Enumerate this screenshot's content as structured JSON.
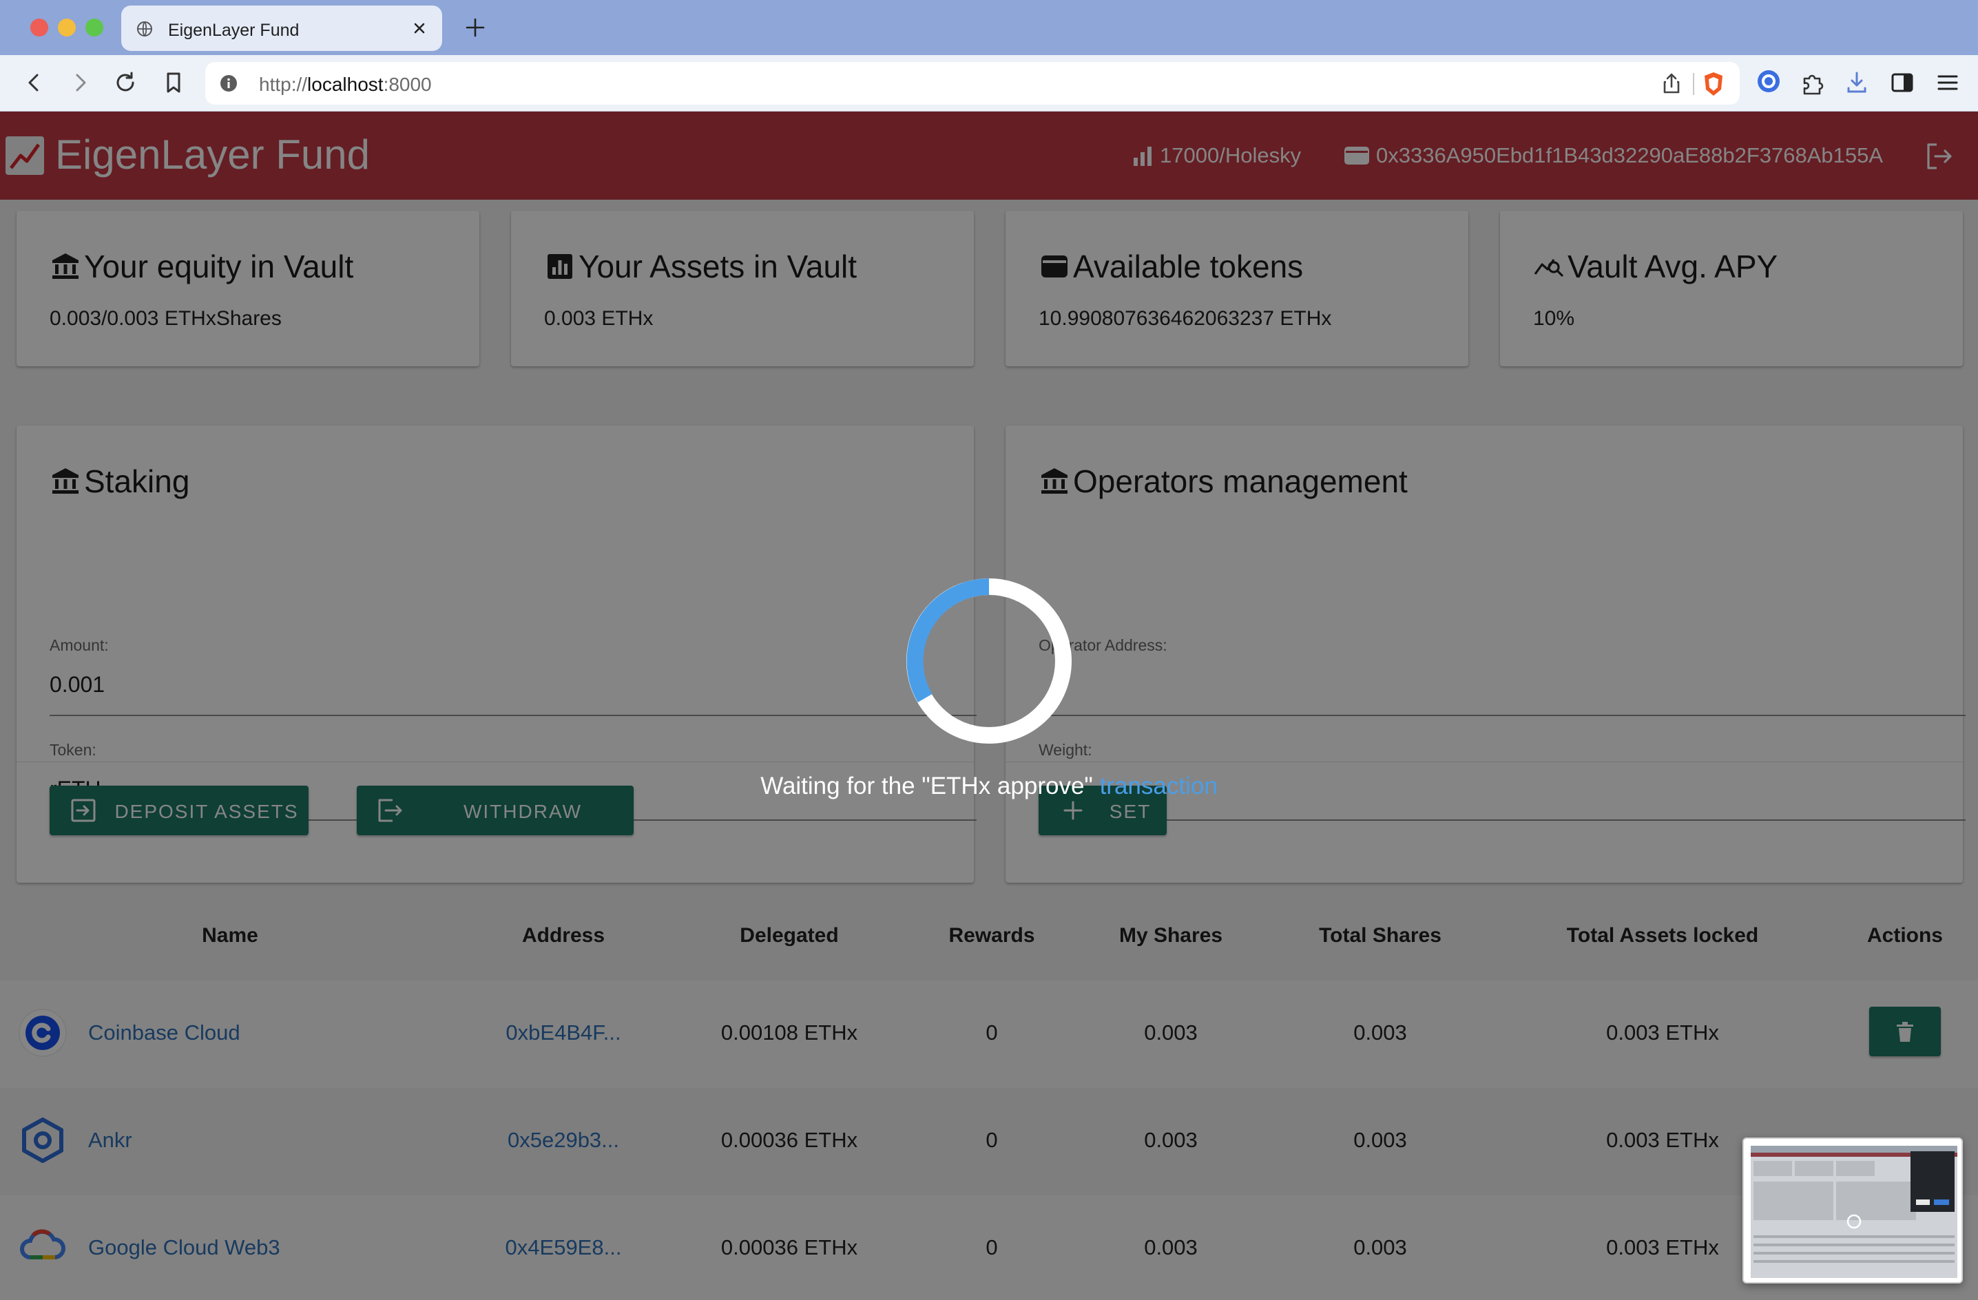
{
  "browser": {
    "tab_title": "EigenLayer Fund",
    "url_prefix": "http://",
    "url_host": "localhost",
    "url_port": ":8000"
  },
  "app": {
    "title": "EigenLayer Fund",
    "network": "17000/Holesky",
    "account": "0x3336A950Ebd1f1B43d32290aE88b2F3768Ab155A",
    "colors": {
      "appbar": "#c23b45",
      "primary_button": "#1d7a66",
      "link": "#2f6fb7",
      "spinner_accent": "#4a9ee8"
    }
  },
  "stats": [
    {
      "title": "Your equity in Vault",
      "value": "0.003/0.003 ETHxShares",
      "icon": "bank-icon"
    },
    {
      "title": "Your Assets in Vault",
      "value": "0.003 ETHx",
      "icon": "chart-box-icon"
    },
    {
      "title": "Available tokens",
      "value": "10.990807636462063237 ETHx",
      "icon": "wallet-icon"
    },
    {
      "title": "Vault Avg. APY",
      "value": "10%",
      "icon": "trend-search-icon"
    }
  ],
  "staking": {
    "title": "Staking",
    "amount_label": "Amount:",
    "amount_value": "0.001",
    "token_label": "Token:",
    "token_value": "rETH",
    "deposit_label": "DEPOSIT ASSETS",
    "withdraw_label": "WITHDRAW"
  },
  "operators": {
    "title": "Operators management",
    "address_label": "Operator Address:",
    "weight_label": "Weight:",
    "set_label": "SET"
  },
  "table": {
    "headers": [
      "Name",
      "Address",
      "Delegated",
      "Rewards",
      "My Shares",
      "Total Shares",
      "Total Assets locked",
      "Actions"
    ],
    "rows": [
      {
        "name": "Coinbase Cloud",
        "address": "0xbE4B4F...",
        "delegated": "0.00108 ETHx",
        "rewards": "0",
        "my_shares": "0.003",
        "total_shares": "0.003",
        "total_assets": "0.003 ETHx",
        "logo": "coinbase-logo"
      },
      {
        "name": "Ankr",
        "address": "0x5e29b3...",
        "delegated": "0.00036 ETHx",
        "rewards": "0",
        "my_shares": "0.003",
        "total_shares": "0.003",
        "total_assets": "0.003 ETHx",
        "logo": "ankr-logo"
      },
      {
        "name": "Google Cloud Web3",
        "address": "0x4E59E8...",
        "delegated": "0.00036 ETHx",
        "rewards": "0",
        "my_shares": "0.003",
        "total_shares": "0.003",
        "total_assets": "0.003 ETHx",
        "logo": "google-cloud-logo"
      }
    ]
  },
  "loading": {
    "message": "Waiting for the \"ETHx approve\"",
    "link": "transaction"
  }
}
